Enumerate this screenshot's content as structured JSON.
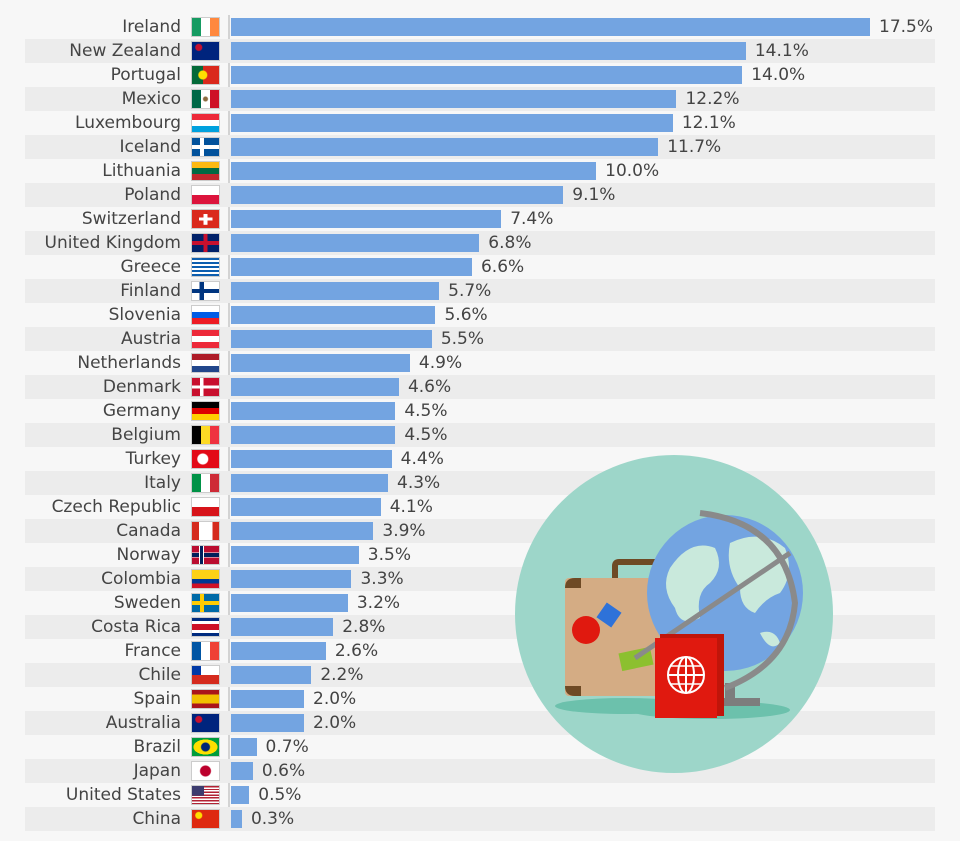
{
  "chart_data": {
    "type": "bar",
    "orientation": "horizontal",
    "title": "",
    "xlabel": "",
    "ylabel": "",
    "value_suffix": "%",
    "xlim": [
      0,
      17.5
    ],
    "grid": false,
    "legend": "none",
    "bar_color": "#73a4e1",
    "categories": [
      "Ireland",
      "New Zealand",
      "Portugal",
      "Mexico",
      "Luxembourg",
      "Iceland",
      "Lithuania",
      "Poland",
      "Switzerland",
      "United Kingdom",
      "Greece",
      "Finland",
      "Slovenia",
      "Austria",
      "Netherlands",
      "Denmark",
      "Germany",
      "Belgium",
      "Turkey",
      "Italy",
      "Czech Republic",
      "Canada",
      "Norway",
      "Colombia",
      "Sweden",
      "Costa Rica",
      "France",
      "Chile",
      "Spain",
      "Australia",
      "Brazil",
      "Japan",
      "United States",
      "China"
    ],
    "values": [
      17.5,
      14.1,
      14.0,
      12.2,
      12.1,
      11.7,
      10.0,
      9.1,
      7.4,
      6.8,
      6.6,
      5.7,
      5.6,
      5.5,
      4.9,
      4.6,
      4.5,
      4.5,
      4.4,
      4.3,
      4.1,
      3.9,
      3.5,
      3.3,
      3.2,
      2.8,
      2.6,
      2.2,
      2.0,
      2.0,
      0.7,
      0.6,
      0.5,
      0.3
    ],
    "data_labels": [
      "17.5%",
      "14.1%",
      "14.0%",
      "12.2%",
      "12.1%",
      "11.7%",
      "10.0%",
      "9.1%",
      "7.4%",
      "6.8%",
      "6.6%",
      "5.7%",
      "5.6%",
      "5.5%",
      "4.9%",
      "4.6%",
      "4.5%",
      "4.5%",
      "4.4%",
      "4.3%",
      "4.1%",
      "3.9%",
      "3.5%",
      "3.3%",
      "3.2%",
      "2.8%",
      "2.6%",
      "2.2%",
      "2.0%",
      "2.0%",
      "0.7%",
      "0.6%",
      "0.5%",
      "0.3%"
    ],
    "flags": [
      "ireland-flag-icon",
      "new-zealand-flag-icon",
      "portugal-flag-icon",
      "mexico-flag-icon",
      "luxembourg-flag-icon",
      "iceland-flag-icon",
      "lithuania-flag-icon",
      "poland-flag-icon",
      "switzerland-flag-icon",
      "united-kingdom-flag-icon",
      "greece-flag-icon",
      "finland-flag-icon",
      "slovenia-flag-icon",
      "austria-flag-icon",
      "netherlands-flag-icon",
      "denmark-flag-icon",
      "germany-flag-icon",
      "belgium-flag-icon",
      "turkey-flag-icon",
      "italy-flag-icon",
      "czech-republic-flag-icon",
      "canada-flag-icon",
      "norway-flag-icon",
      "colombia-flag-icon",
      "sweden-flag-icon",
      "costa-rica-flag-icon",
      "france-flag-icon",
      "chile-flag-icon",
      "spain-flag-icon",
      "australia-flag-icon",
      "brazil-flag-icon",
      "japan-flag-icon",
      "united-states-flag-icon",
      "china-flag-icon"
    ]
  },
  "illustration": {
    "name": "travel-illustration",
    "elements": [
      "suitcase-icon",
      "globe-icon",
      "passport-icon"
    ]
  }
}
